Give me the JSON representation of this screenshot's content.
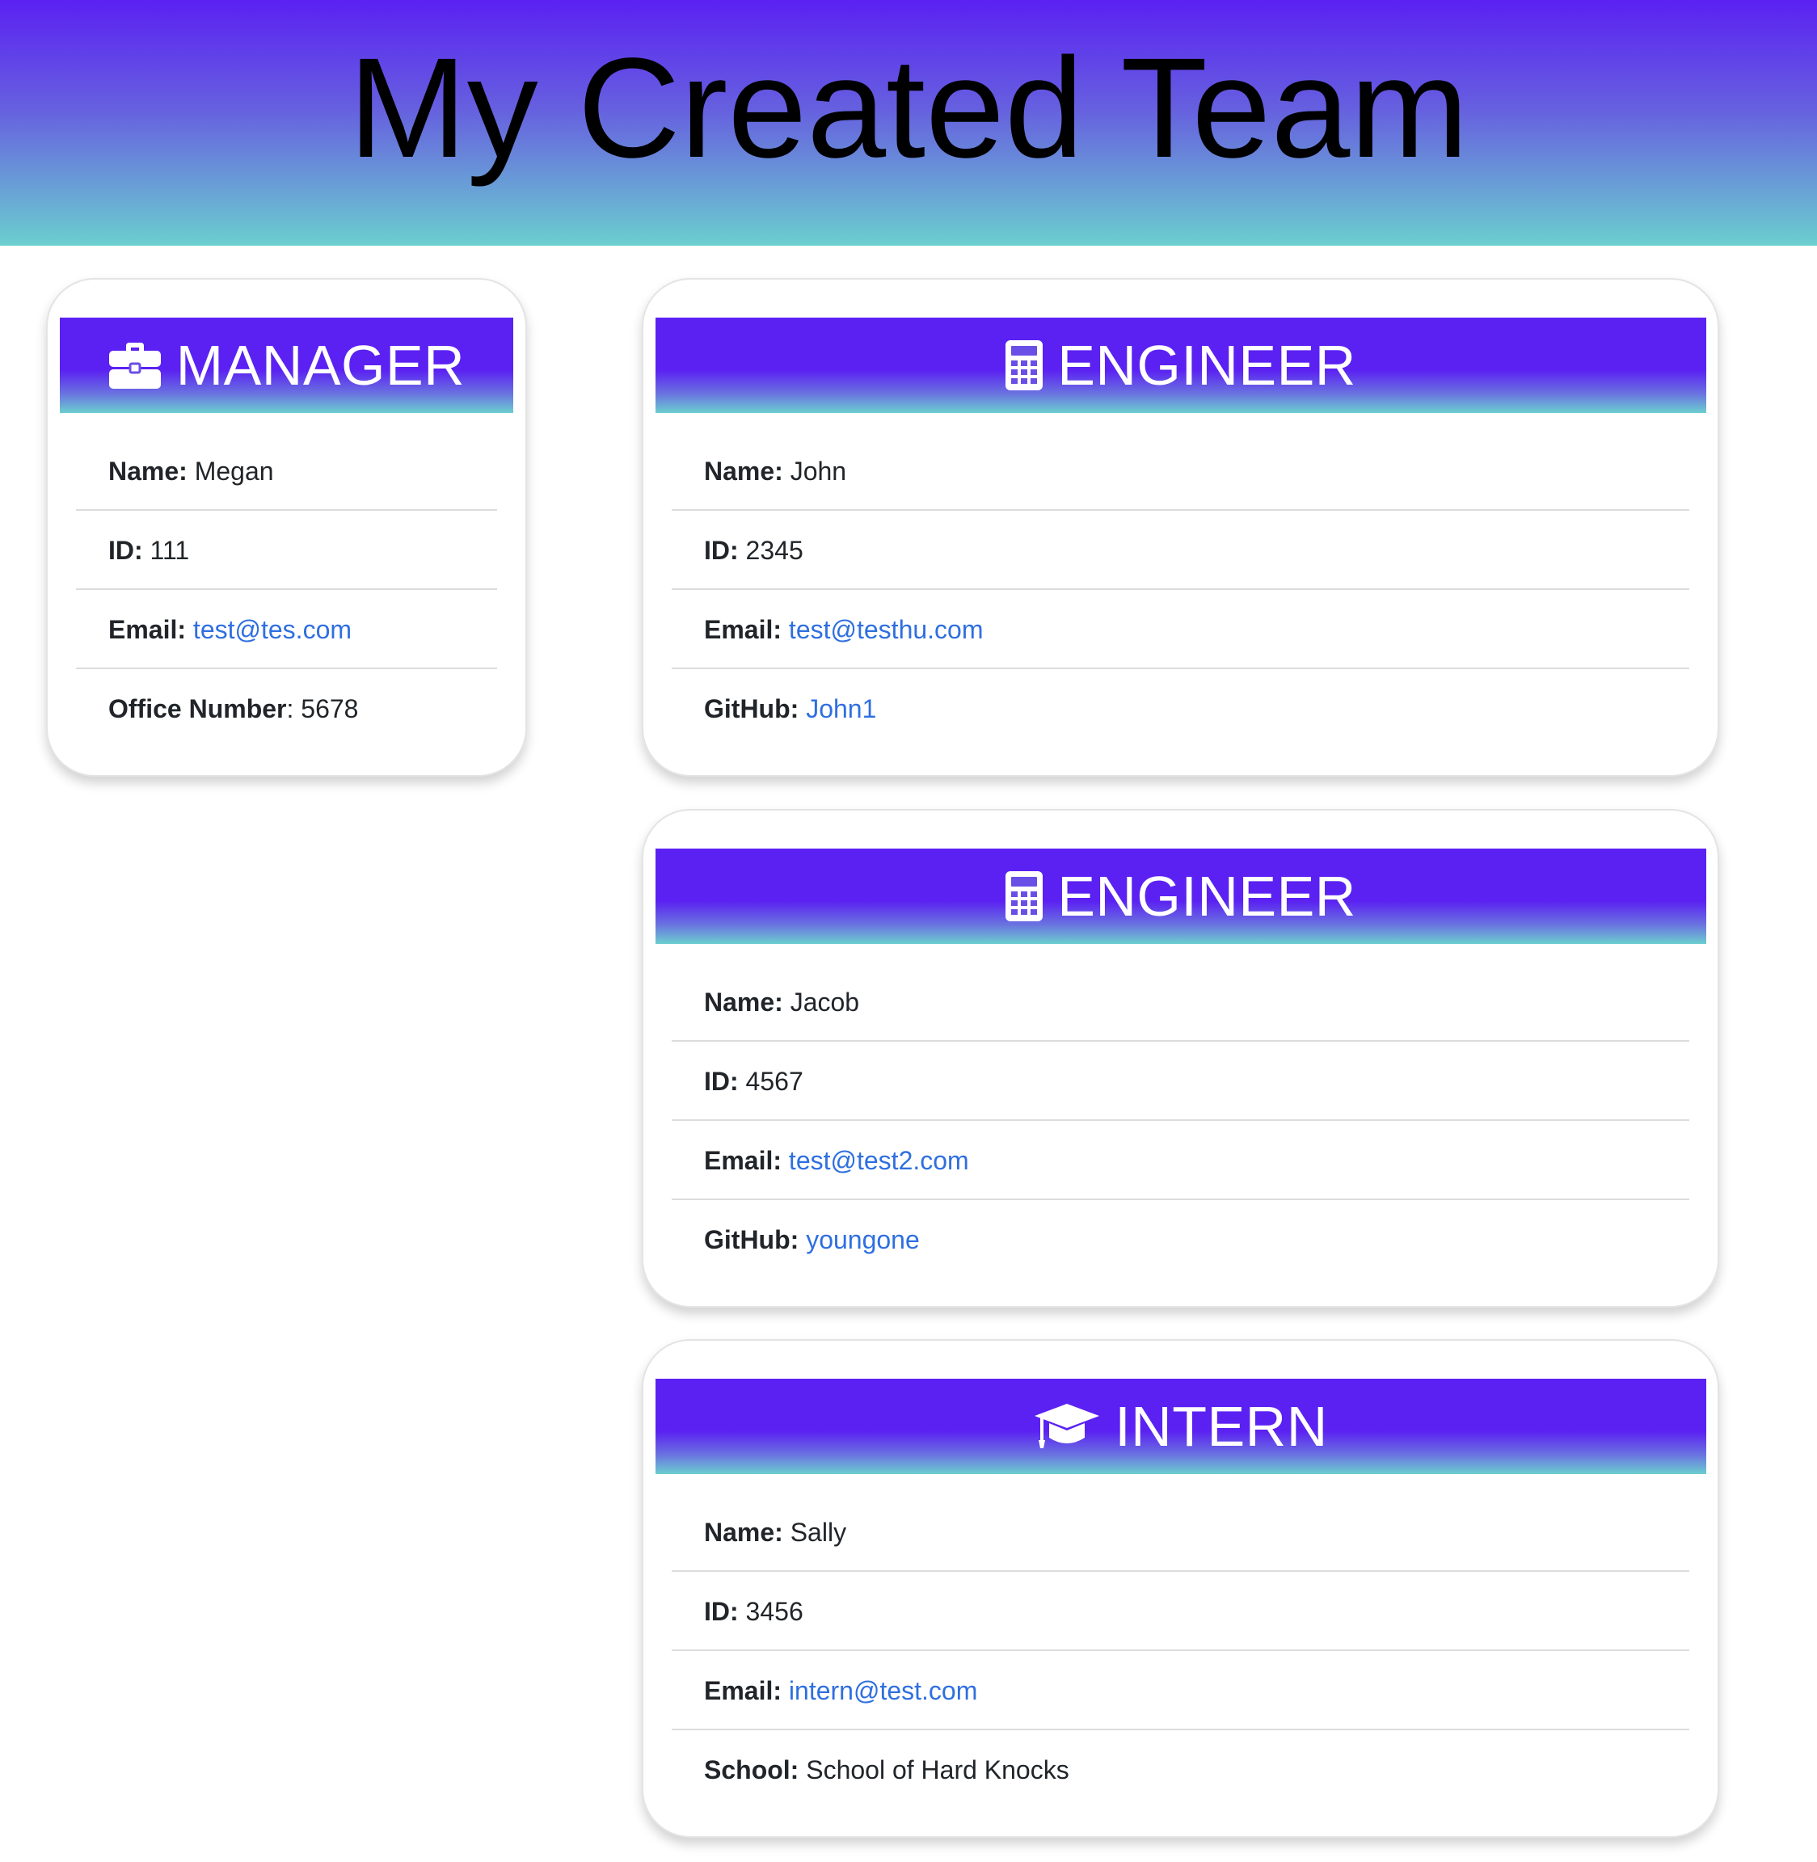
{
  "page": {
    "title": "My Created Team"
  },
  "colors": {
    "header_top": "#5b21f2",
    "header_bottom": "#6bcfcf",
    "link": "#2f6fe0"
  },
  "cards": [
    {
      "role": "MANAGER",
      "icon": "briefcase-icon",
      "fields": [
        {
          "label": "Name:",
          "value": "Megan",
          "link": false
        },
        {
          "label": "ID:",
          "value": "111",
          "link": false
        },
        {
          "label": "Email:",
          "value": "test@tes.com",
          "link": true
        },
        {
          "label": "Office Number",
          "value": "5678",
          "link": false
        }
      ]
    },
    {
      "role": "ENGINEER",
      "icon": "calculator-icon",
      "fields": [
        {
          "label": "Name:",
          "value": "John",
          "link": false
        },
        {
          "label": "ID:",
          "value": "2345",
          "link": false
        },
        {
          "label": "Email:",
          "value": "test@testhu.com",
          "link": true
        },
        {
          "label": "GitHub:",
          "value": "John1",
          "link": true
        }
      ]
    },
    {
      "role": "ENGINEER",
      "icon": "calculator-icon",
      "fields": [
        {
          "label": "Name:",
          "value": "Jacob",
          "link": false
        },
        {
          "label": "ID:",
          "value": "4567",
          "link": false
        },
        {
          "label": "Email:",
          "value": "test@test2.com",
          "link": true
        },
        {
          "label": "GitHub:",
          "value": "youngone",
          "link": true
        }
      ]
    },
    {
      "role": "INTERN",
      "icon": "graduation-cap-icon",
      "fields": [
        {
          "label": "Name:",
          "value": "Sally",
          "link": false
        },
        {
          "label": "ID:",
          "value": "3456",
          "link": false
        },
        {
          "label": "Email:",
          "value": "intern@test.com",
          "link": true
        },
        {
          "label": "School:",
          "value": "School of Hard Knocks",
          "link": false
        }
      ]
    }
  ]
}
